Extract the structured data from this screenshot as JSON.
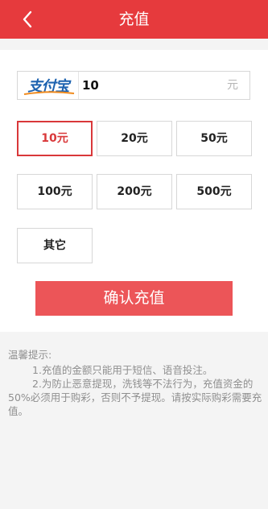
{
  "header": {
    "title": "充值"
  },
  "payment": {
    "method_logo_text": "支付宝",
    "amount_value": "10",
    "unit": "元"
  },
  "options": {
    "o10": "10元",
    "o20": "20元",
    "o50": "50元",
    "o100": "100元",
    "o200": "200元",
    "o500": "500元",
    "other": "其它",
    "selected": "10元"
  },
  "confirm_label": "确认充值",
  "tips": {
    "title": "温馨提示:",
    "line1": "1.充值的金额只能用于短信、语音投注。",
    "line2": "2.为防止恶意提现，洗钱等不法行为，充值资金的50%必须用于购彩，否则不予提现。请按实际购彩需要充值。"
  },
  "colors": {
    "header_bg": "#e63a3d",
    "selected_border": "#d9383a",
    "confirm_bg": "#ec5558"
  }
}
